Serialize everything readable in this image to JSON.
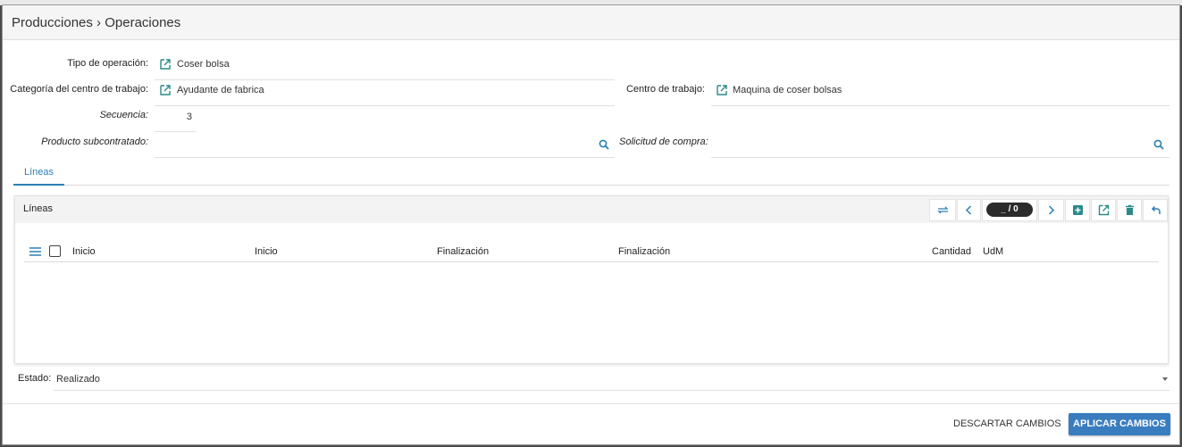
{
  "dialog": {
    "title": "Producciones › Operaciones"
  },
  "form": {
    "tipo_operacion": {
      "label": "Tipo de operación:",
      "value": "Coser bolsa"
    },
    "categoria_centro": {
      "label": "Categoría del centro de trabajo:",
      "value": "Ayudante de fabrica"
    },
    "centro_trabajo": {
      "label": "Centro de trabajo:",
      "value": "Maquina de coser bolsas"
    },
    "secuencia": {
      "label": "Secuencia:",
      "value": "3"
    },
    "producto_subcontratado": {
      "label": "Producto subcontratado:",
      "value": ""
    },
    "solicitud_compra": {
      "label": "Solicitud de compra:",
      "value": ""
    }
  },
  "tabs": [
    {
      "label": "Líneas",
      "active": true
    }
  ],
  "lines_panel": {
    "title": "Líneas",
    "pager": "_ / 0",
    "toolbar_icons": [
      "switch-view-icon",
      "previous-icon",
      "next-icon",
      "add-icon",
      "open-icon",
      "delete-icon",
      "undo-icon"
    ],
    "columns": [
      "Inicio",
      "Inicio",
      "Finalización",
      "Finalización",
      "Cantidad",
      "UdM"
    ],
    "rows": []
  },
  "estado": {
    "label": "Estado:",
    "value": "Realizado"
  },
  "footer": {
    "discard_label": "DESCARTAR CAMBIOS",
    "apply_label": "APLICAR CAMBIOS"
  },
  "colors": {
    "accent": "#2a7fb5",
    "primary_button": "#3a7dbf",
    "icon_teal": "#2a8a8a"
  }
}
